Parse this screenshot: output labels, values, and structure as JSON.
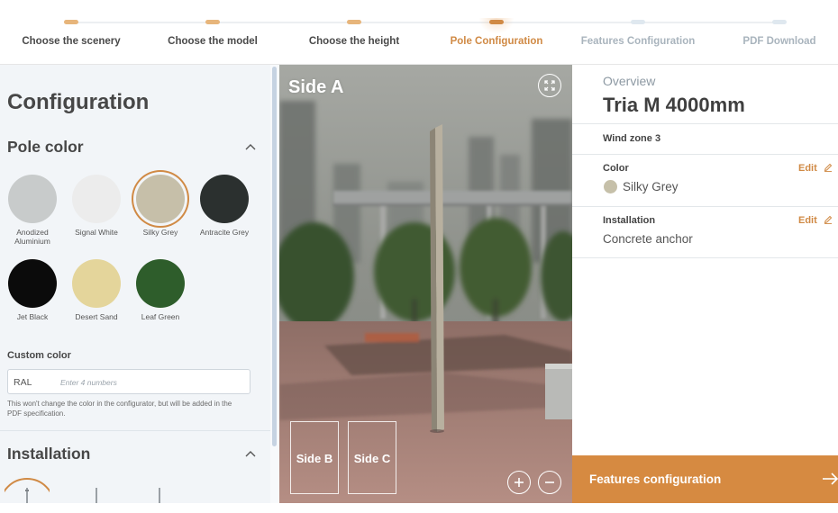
{
  "stepper": {
    "steps": [
      {
        "label": "Choose the scenery",
        "state": "done"
      },
      {
        "label": "Choose the model",
        "state": "done"
      },
      {
        "label": "Choose the height",
        "state": "done"
      },
      {
        "label": "Pole Configuration",
        "state": "active"
      },
      {
        "label": "Features Configuration",
        "state": "todo"
      },
      {
        "label": "PDF Download",
        "state": "todo"
      }
    ]
  },
  "left": {
    "title": "Configuration",
    "pole_color": {
      "title": "Pole color",
      "swatches": [
        {
          "name": "Anodized Aluminium",
          "color": "#c8cbcb"
        },
        {
          "name": "Signal White",
          "color": "#ececec"
        },
        {
          "name": "Silky Grey",
          "color": "#c6bfa9",
          "selected": true
        },
        {
          "name": "Antracite Grey",
          "color": "#2b302f"
        },
        {
          "name": "Jet Black",
          "color": "#0b0b0b"
        },
        {
          "name": "Desert Sand",
          "color": "#e4d59b"
        },
        {
          "name": "Leaf Green",
          "color": "#2e5d2b"
        }
      ]
    },
    "custom_color": {
      "label": "Custom color",
      "prefix": "RAL",
      "placeholder": "Enter 4 numbers",
      "value": "",
      "note": "This won't change the color in the configurator, but will be added in the PDF specification."
    },
    "installation": {
      "title": "Installation"
    }
  },
  "viewer": {
    "side_label": "Side A",
    "side_buttons": [
      "Side B",
      "Side C"
    ]
  },
  "overview": {
    "label": "Overview",
    "title": "Tria M 4000mm",
    "wind_zone": "Wind zone 3",
    "color": {
      "label": "Color",
      "edit": "Edit",
      "value": "Silky Grey",
      "swatch": "#c6c0a9"
    },
    "installation": {
      "label": "Installation",
      "edit": "Edit",
      "value": "Concrete anchor"
    },
    "cta": "Features configuration"
  },
  "colors": {
    "accent": "#d68a41",
    "muted": "#a9b4bd"
  }
}
